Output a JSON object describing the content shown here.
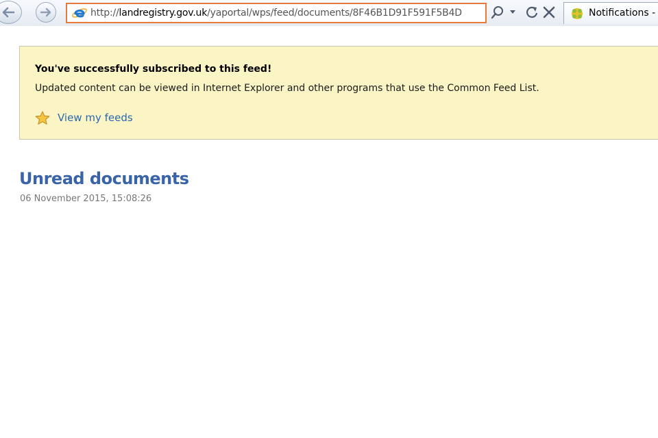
{
  "browser": {
    "address_bar": {
      "url_prefix": "http://",
      "url_domain": "landregistry.gov.uk",
      "url_path": "/yaportal/wps/feed/documents/8F46B1D91F591F5B4D"
    },
    "tab": {
      "label": "Notifications -"
    },
    "icons": {
      "back": "back-arrow-icon",
      "forward": "forward-arrow-icon",
      "browser_logo": "internet-explorer-icon",
      "search": "search-icon",
      "dropdown": "chevron-down-icon",
      "refresh": "refresh-icon",
      "stop": "close-icon",
      "tab_icon": "notifications-icon"
    },
    "accent_color": "#e67a3c"
  },
  "banner": {
    "title": "You've successfully subscribed to this feed!",
    "description": "Updated content can be viewed in Internet Explorer and other programs that use the Common Feed List.",
    "link_label": "View my feeds",
    "link_icon": "star-icon",
    "background_color": "#fbf5c6"
  },
  "feed": {
    "title": "Unread documents",
    "date": "06 November 2015, 15:08:26",
    "title_color": "#3a64a8"
  }
}
